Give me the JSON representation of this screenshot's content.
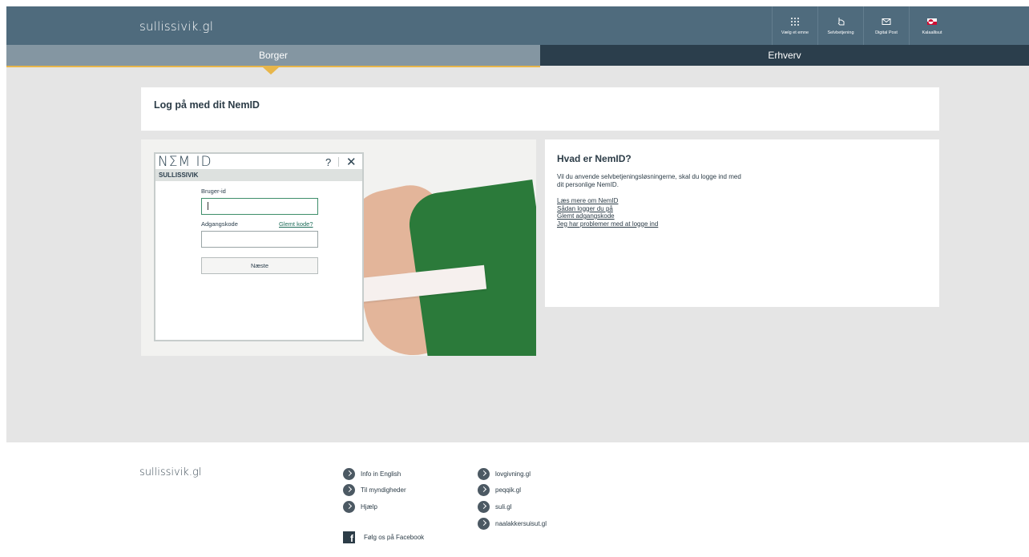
{
  "header": {
    "logo": "sullissivik.gl",
    "tools": [
      {
        "label": "Vælg et emne",
        "icon": "grid-icon"
      },
      {
        "label": "Selvbetjening",
        "icon": "hand-pointer-icon"
      },
      {
        "label": "Digital Post",
        "icon": "mail-icon"
      },
      {
        "label": "Kalaallisut",
        "icon": "greenland-flag-icon"
      }
    ]
  },
  "nav": {
    "tabs": [
      {
        "label": "Borger",
        "active": true
      },
      {
        "label": "Erhverv",
        "active": false
      }
    ],
    "accent": "#e8b64a"
  },
  "page": {
    "title": "Log på med dit NemID"
  },
  "nemid": {
    "logo": "NΣM ID",
    "help": "?",
    "close": "✕",
    "org": "SULLISSIVIK",
    "user_label": "Bruger-id",
    "user_value": "",
    "password_label": "Adgangskode",
    "forgot_link": "Glemt kode?",
    "password_value": "",
    "next_button": "Næste"
  },
  "info": {
    "title": "Hvad er NemID?",
    "text": "Vil du anvende selvbetjeningsløsningerne, skal du logge ind med dit personlige NemID.",
    "links": [
      "Læs mere om NemID",
      "Sådan logger du på",
      "Glemt adgangskode",
      "Jeg har problemer med at logge ind"
    ]
  },
  "footer": {
    "logo": "sullissivik.gl",
    "col1": [
      "Info in English",
      "Til myndigheder",
      "Hjælp"
    ],
    "col2": [
      "lovgivning.gl",
      "peqqik.gl",
      "suli.gl",
      "naalakkersuisut.gl"
    ],
    "facebook": "Følg os på Facebook"
  },
  "colors": {
    "header_bg": "#4f6b7d",
    "nav_active": "#8496a2",
    "nav_inactive": "#2b3e4c",
    "link_green": "#1f6d5a"
  }
}
